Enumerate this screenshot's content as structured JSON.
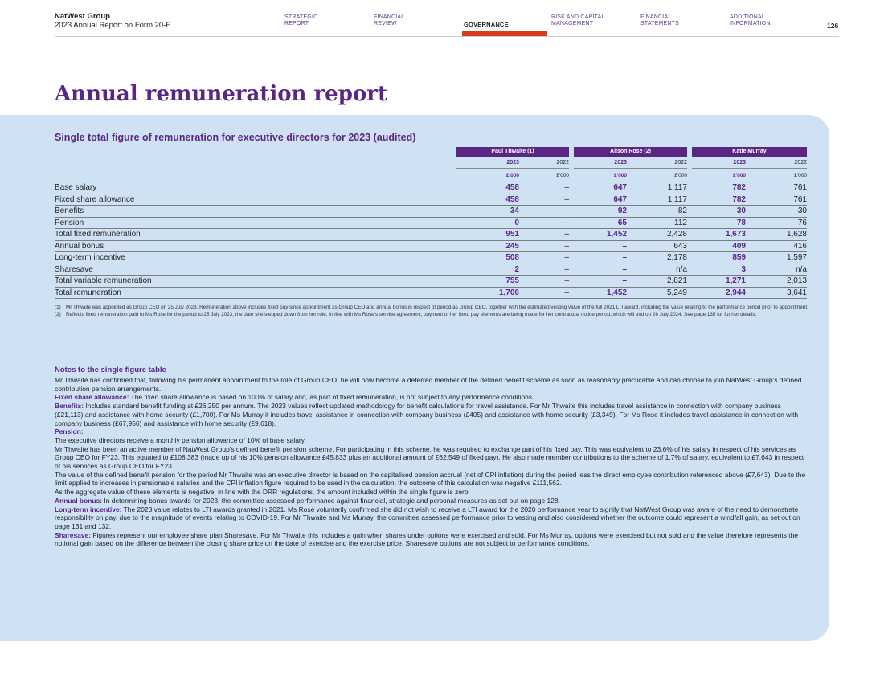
{
  "header": {
    "org": "NatWest Group",
    "subtitle": "2023 Annual Report on Form 20-F",
    "nav": [
      {
        "line1": "STRATEGIC",
        "line2": "REPORT"
      },
      {
        "line1": "FINANCIAL",
        "line2": "REVIEW"
      },
      {
        "line1": "GOVERNANCE",
        "line2": ""
      },
      {
        "line1": "RISK AND CAPITAL",
        "line2": "MANAGEMENT"
      },
      {
        "line1": "FINANCIAL",
        "line2": "STATEMENTS"
      },
      {
        "line1": "ADDITIONAL",
        "line2": "INFORMATION"
      }
    ],
    "page_number": "126",
    "accent": "#d73b1a"
  },
  "title": "Annual remuneration report",
  "table": {
    "title": "Single total figure of remuneration for executive directors for 2023 (audited)",
    "executives": [
      {
        "name": "Paul Thwaite (1)",
        "y1": "2023",
        "y2": "2022",
        "u1": "£'000",
        "u2": "£'000"
      },
      {
        "name": "Alison Rose (2)",
        "y1": "2023",
        "y2": "2022",
        "u1": "£'000",
        "u2": "£'000"
      },
      {
        "name": "Katie Murray",
        "y1": "2023",
        "y2": "2022",
        "u1": "£'000",
        "u2": "£'000"
      }
    ],
    "rows": [
      {
        "label": "Base salary",
        "v": [
          "458",
          "–",
          "647",
          "1,117",
          "782",
          "761"
        ]
      },
      {
        "label": "Fixed share allowance",
        "v": [
          "458",
          "–",
          "647",
          "1,117",
          "782",
          "761"
        ]
      },
      {
        "label": "Benefits",
        "v": [
          "34",
          "–",
          "92",
          "82",
          "30",
          "30"
        ]
      },
      {
        "label": "Pension",
        "v": [
          "0",
          "–",
          "65",
          "112",
          "78",
          "76"
        ]
      },
      {
        "label": "Total fixed remuneration",
        "v": [
          "951",
          "–",
          "1,452",
          "2,428",
          "1,673",
          "1,628"
        ]
      },
      {
        "label": "Annual bonus",
        "v": [
          "245",
          "–",
          "–",
          "643",
          "409",
          "416"
        ]
      },
      {
        "label": "Long-term incentive",
        "v": [
          "508",
          "–",
          "–",
          "2,178",
          "859",
          "1,597"
        ]
      },
      {
        "label": "Sharesave",
        "v": [
          "2",
          "–",
          "–",
          "n/a",
          "3",
          "n/a"
        ]
      },
      {
        "label": "Total variable remuneration",
        "v": [
          "755",
          "–",
          "–",
          "2,821",
          "1,271",
          "2,013"
        ]
      },
      {
        "label": "Total remuneration",
        "v": [
          "1,706",
          "–",
          "1,452",
          "5,249",
          "2,944",
          "3,641"
        ]
      }
    ],
    "colors": {
      "head": "#5b2683",
      "panel": "#cfe2f4"
    }
  },
  "footnotes": [
    {
      "n": "(1)",
      "text": "Mr Thwaite was appointed as Group CEO on 25 July 2023. Remuneration above includes fixed pay since appointment as Group CEO and annual bonus in respect of period as Group CEO, together with the estimated vesting value of the full 2021 LTI award, including the value relating to the performance period prior to appointment."
    },
    {
      "n": "(2)",
      "text": "Reflects fixed remuneration paid to Ms Rose for the period to 25 July 2023, the date she stepped down from her role. In line with Ms Rose's service agreement, payment of her fixed pay elements are being made for her contractual notice period, which will end on 26 July 2024. See page 135 for further details."
    }
  ],
  "notes": {
    "heading": "Notes to the single figure table",
    "intro": "Mr Thwaite has confirmed that, following his permanent appointment to the role of Group CEO, he will now become a deferred member of the defined benefit scheme as soon as reasonably practicable and can choose to join NatWest Group's defined contribution pension arrangements.",
    "fsa_k": "Fixed share allowance:",
    "fsa": " The fixed share allowance is based on 100% of salary and, as part of fixed remuneration, is not subject to any performance conditions.",
    "ben_k": "Benefits:",
    "ben": " Includes standard benefit funding at £26,250 per annum. The 2023 values reflect updated methodology for benefit calculations for travel assistance. For Mr Thwaite this includes travel assistance in connection with company business (£21,113) and assistance with home security (£1,700). For Ms Murray it includes travel assistance in connection with company business (£405) and assistance with home security (£3,349). For Ms Rose it includes travel assistance in connection with company business (£67,956) and assistance with home security (£9,618).",
    "pen_k": "Pension:",
    "pen1": "The executive directors receive a monthly pension allowance of 10% of base salary.",
    "pen2": "Mr Thwaite has been an active member of NatWest Group's defined benefit pension scheme. For participating in this scheme, he was required to exchange part of his fixed pay. This was equivalent to 23.6% of his salary in respect of his services as Group CEO for FY23. This equated to £108,383 (made up of his 10% pension allowance £45,833 plus an additional amount of £62,549 of fixed pay). He also made member contributions to the scheme of 1.7% of salary, equivalent to £7,643 in respect of his services as Group CEO for FY23.",
    "pen3": "The value of the defined benefit pension for the period Mr Thwaite was an executive director is based on the capitalised pension accrual (net of CPI inflation) during the period less the direct employee contribution referenced above (£7,643). Due to the limit applied to increases in pensionable salaries and the CPI inflation figure required to be used in the calculation, the outcome of this calculation was negative £111,562.",
    "pen4": "As the aggregate value of these elements is negative, in line with the DRR regulations, the amount included within the single figure is zero.",
    "ab_k": "Annual bonus:",
    "ab": " In determining bonus awards for 2023, the committee assessed performance against financial, strategic and personal measures as set out on page 128.",
    "lti_k": "Long-term incentive:",
    "lti": " The 2023 value relates to LTI awards granted in 2021. Ms Rose voluntarily confirmed she did not wish to receive a LTI award for the 2020 performance year to signify that NatWest Group was aware of the need to demonstrate responsibility on pay, due to the magnitude of events relating to COVID-19. For Mr Thwaite and Ms Murray, the committee assessed performance prior to vesting and also considered whether the outcome could represent a windfall gain, as set out on page 131 and 132.",
    "ss_k": "Sharesave:",
    "ss": " Figures represent our employee share plan Sharesave. For Mr Thwaite this includes a gain when shares under options were exercised and sold. For Ms Murray, options were exercised but not sold and the value therefore represents the notional gain based on the difference between the closing share price on the date of exercise and the exercise price. Sharesave options are not subject to performance conditions."
  }
}
